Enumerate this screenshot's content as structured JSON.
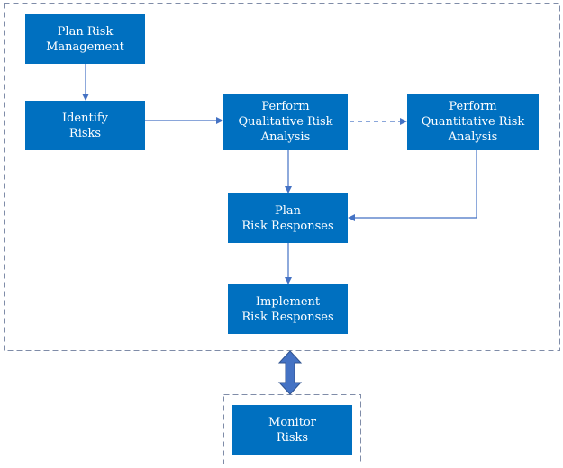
{
  "colors": {
    "box": "#0070C0",
    "connector": "#4472C4",
    "border": "#7F8CA8"
  },
  "nodes": {
    "plan_risk_management": [
      "Plan Risk",
      "Management"
    ],
    "identify_risks": [
      "Identify",
      "Risks"
    ],
    "qualitative": [
      "Perform",
      "Qualitative Risk",
      "Analysis"
    ],
    "quantitative": [
      "Perform",
      "Quantitative Risk",
      "Analysis"
    ],
    "plan_responses": [
      "Plan",
      "Risk Responses"
    ],
    "implement_responses": [
      "Implement",
      "Risk Responses"
    ],
    "monitor_risks": [
      "Monitor",
      "Risks"
    ]
  },
  "edges": [
    {
      "from": "plan_risk_management",
      "to": "identify_risks",
      "style": "solid"
    },
    {
      "from": "identify_risks",
      "to": "qualitative",
      "style": "solid"
    },
    {
      "from": "qualitative",
      "to": "quantitative",
      "style": "dashed"
    },
    {
      "from": "qualitative",
      "to": "plan_responses",
      "style": "solid"
    },
    {
      "from": "quantitative",
      "to": "plan_responses",
      "style": "solid"
    },
    {
      "from": "plan_responses",
      "to": "implement_responses",
      "style": "solid"
    },
    {
      "from": "process_group",
      "to": "monitor_risks",
      "style": "double-arrow"
    }
  ]
}
